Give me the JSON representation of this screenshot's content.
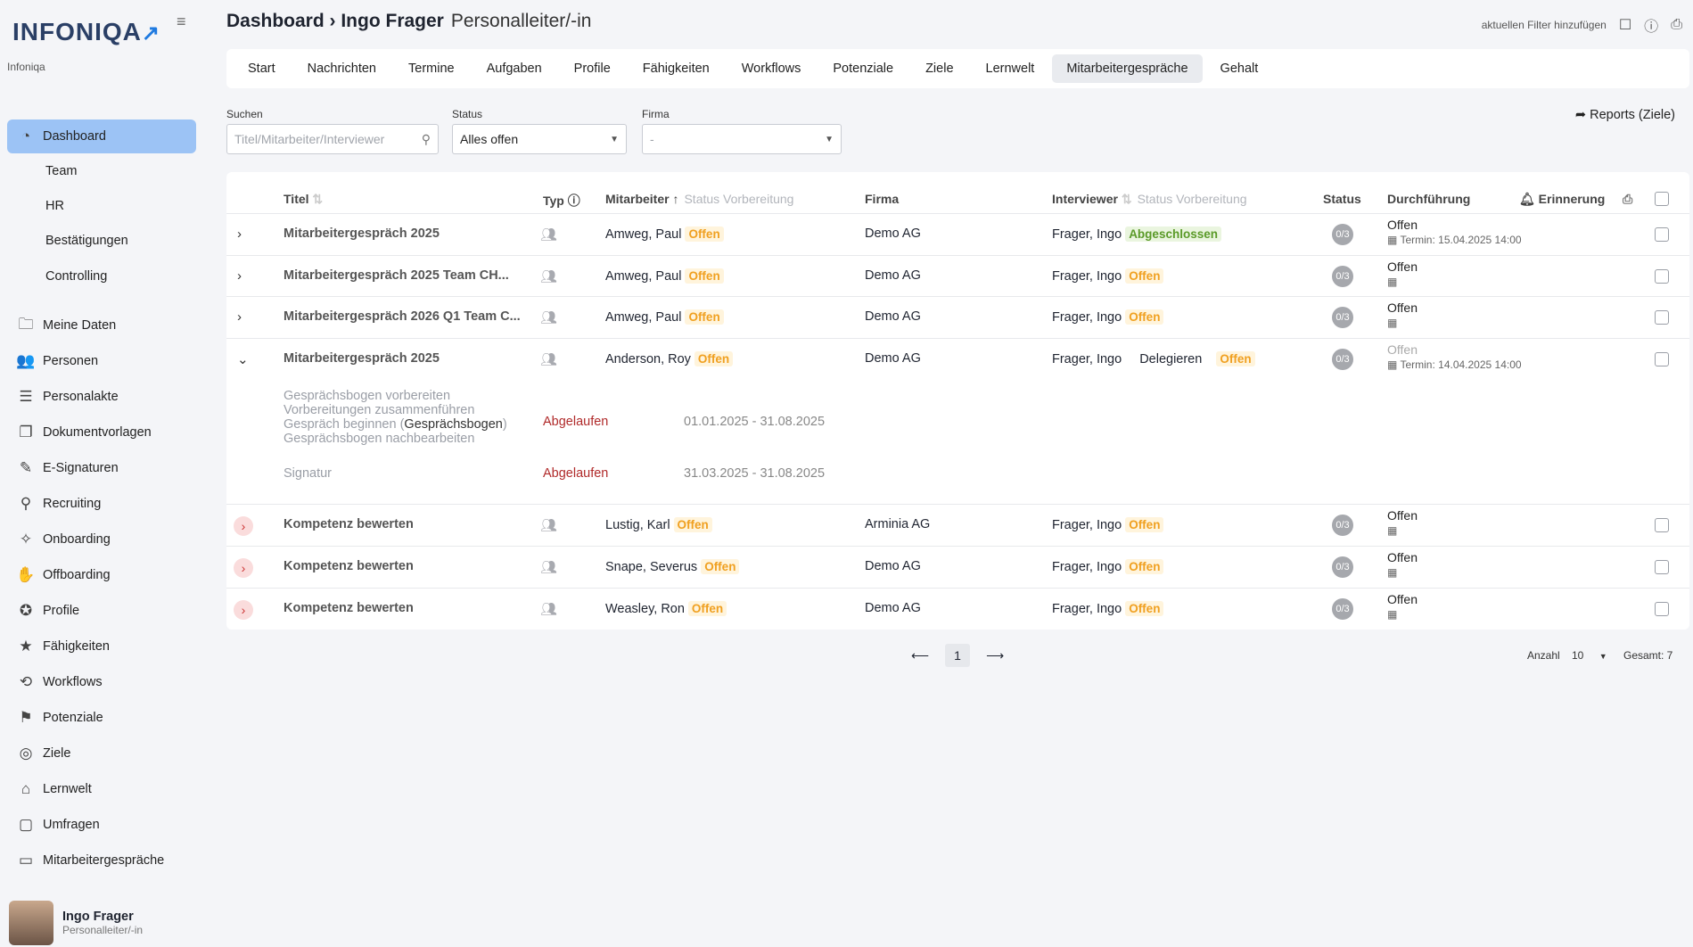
{
  "brand": {
    "logo_text": "INFONIQA",
    "logo_arrow": "↗",
    "tenant": "Infoniqa"
  },
  "sidebar": {
    "items": [
      {
        "label": "Dashboard",
        "icon": "dashboard-icon",
        "glyph": "◔",
        "active": true
      },
      {
        "label": "Meine Daten",
        "icon": "folder-icon",
        "glyph": "🗀"
      },
      {
        "label": "Personen",
        "icon": "people-icon",
        "glyph": "👥"
      },
      {
        "label": "Personalakte",
        "icon": "file-list-icon",
        "glyph": "☰"
      },
      {
        "label": "Dokumentvorlagen",
        "icon": "documents-icon",
        "glyph": "❐"
      },
      {
        "label": "E-Signaturen",
        "icon": "pen-icon",
        "glyph": "✎"
      },
      {
        "label": "Recruiting",
        "icon": "recruiting-icon",
        "glyph": "⚲"
      },
      {
        "label": "Onboarding",
        "icon": "handshake-icon",
        "glyph": "✧"
      },
      {
        "label": "Offboarding",
        "icon": "hand-icon",
        "glyph": "✋"
      },
      {
        "label": "Profile",
        "icon": "profile-icon",
        "glyph": "✪"
      },
      {
        "label": "Fähigkeiten",
        "icon": "star-box-icon",
        "glyph": "★"
      },
      {
        "label": "Workflows",
        "icon": "workflow-icon",
        "glyph": "⟲"
      },
      {
        "label": "Potenziale",
        "icon": "flag-icon",
        "glyph": "⚑"
      },
      {
        "label": "Ziele",
        "icon": "target-icon",
        "glyph": "◎"
      },
      {
        "label": "Lernwelt",
        "icon": "graduation-icon",
        "glyph": "⌂"
      },
      {
        "label": "Umfragen",
        "icon": "clipboard-icon",
        "glyph": "▢"
      },
      {
        "label": "Mitarbeitergespräche",
        "icon": "chat-icon",
        "glyph": "▭"
      }
    ],
    "subitems": [
      "Team",
      "HR",
      "Bestätigungen",
      "Controlling"
    ]
  },
  "user": {
    "name": "Ingo Frager",
    "role": "Personalleiter/-in"
  },
  "header": {
    "breadcrumb": "Dashboard › Ingo Frager",
    "role": "Personalleiter/-in",
    "add_filter": "aktuellen Filter hinzufügen"
  },
  "tabs": [
    "Start",
    "Nachrichten",
    "Termine",
    "Aufgaben",
    "Profile",
    "Fähigkeiten",
    "Workflows",
    "Potenziale",
    "Ziele",
    "Lernwelt",
    "Mitarbeitergespräche",
    "Gehalt"
  ],
  "active_tab": "Mitarbeitergespräche",
  "filters": {
    "search_label": "Suchen",
    "search_placeholder": "Titel/Mitarbeiter/Interviewer",
    "status_label": "Status",
    "status_value": "Alles offen",
    "firma_label": "Firma",
    "firma_value": "-",
    "reports": "Reports (Ziele)"
  },
  "table": {
    "headers": {
      "titel": "Titel",
      "typ": "Typ",
      "mitarbeiter": "Mitarbeiter",
      "status_vorb1": "Status Vorbereitung",
      "firma": "Firma",
      "interviewer": "Interviewer",
      "status_vorb2": "Status Vorbereitung",
      "status": "Status",
      "durchfuehrung": "Durchführung",
      "erinnerung": "Erinnerung"
    },
    "rows": [
      {
        "title": "Mitarbeitergespräch 2025",
        "employee": "Amweg, Paul",
        "emp_status": "Offen",
        "company": "Demo AG",
        "interviewer": "Frager, Ingo",
        "int_status": "Abgeschlossen",
        "stat": "0/3",
        "exec": "Offen",
        "termin": "Termin: 15.04.2025 14:00"
      },
      {
        "title": "Mitarbeitergespräch 2025 Team CH...",
        "employee": "Amweg, Paul",
        "emp_status": "Offen",
        "company": "Demo AG",
        "interviewer": "Frager, Ingo",
        "int_status": "Offen",
        "stat": "0/3",
        "exec": "Offen",
        "termin": ""
      },
      {
        "title": "Mitarbeitergespräch 2026 Q1 Team C...",
        "employee": "Amweg, Paul",
        "emp_status": "Offen",
        "company": "Demo AG",
        "interviewer": "Frager, Ingo",
        "int_status": "Offen",
        "stat": "0/3",
        "exec": "Offen",
        "termin": ""
      },
      {
        "title": "Mitarbeitergespräch 2025",
        "employee": "Anderson, Roy",
        "emp_status": "Offen",
        "company": "Demo AG",
        "interviewer": "Frager, Ingo",
        "delegate": "Delegieren",
        "int_status": "Offen",
        "stat": "0/3",
        "exec": "Offen",
        "termin": "Termin: 14.04.2025 14:00"
      },
      {
        "title": "Kompetenz bewerten",
        "employee": "Lustig, Karl",
        "emp_status": "Offen",
        "company": "Arminia AG",
        "interviewer": "Frager, Ingo",
        "int_status": "Offen",
        "stat": "0/3",
        "exec": "Offen",
        "termin": ""
      },
      {
        "title": "Kompetenz bewerten",
        "employee": "Snape, Severus",
        "emp_status": "Offen",
        "company": "Demo AG",
        "interviewer": "Frager, Ingo",
        "int_status": "Offen",
        "stat": "0/3",
        "exec": "Offen",
        "termin": ""
      },
      {
        "title": "Kompetenz bewerten",
        "employee": "Weasley, Ron",
        "emp_status": "Offen",
        "company": "Demo AG",
        "interviewer": "Frager, Ingo",
        "int_status": "Offen",
        "stat": "0/3",
        "exec": "Offen",
        "termin": ""
      }
    ],
    "expanded": {
      "steps_pre": "Gesprächsbogen vorbereiten",
      "steps_merge": "Vorbereitungen zusammenführen",
      "steps_begin_a": "Gespräch beginnen (",
      "steps_begin_link": "Gesprächsbogen",
      "steps_begin_b": ")",
      "steps_post": "Gesprächsbogen nachbearbeiten",
      "status1": "Abgelaufen",
      "range1": "01.01.2025 - 31.08.2025",
      "sig": "Signatur",
      "status2": "Abgelaufen",
      "range2": "31.03.2025 - 31.08.2025"
    }
  },
  "pagination": {
    "prev": "⟵",
    "page": "1",
    "next": "⟶",
    "count_label": "Anzahl",
    "count_value": "10",
    "total": "Gesamt: 7"
  }
}
